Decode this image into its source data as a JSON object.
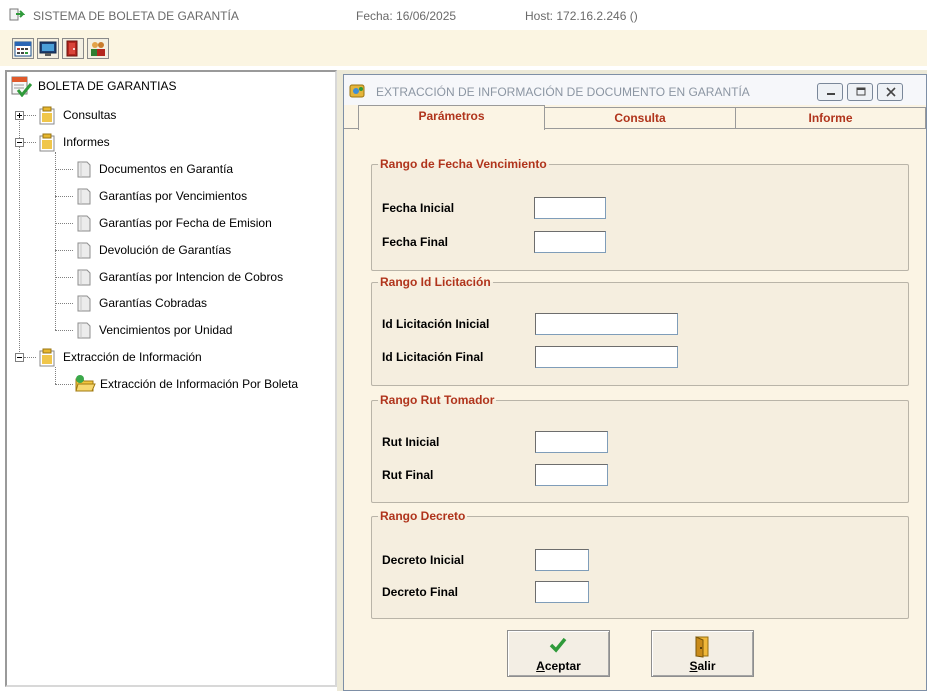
{
  "header": {
    "app_title": "SISTEMA DE BOLETA DE GARANTÍA",
    "date": "Fecha: 16/06/2025",
    "host": "Host: 172.16.2.246 ()"
  },
  "toolbar": {
    "buttons": [
      "calendar-icon",
      "monitor-icon",
      "exit-door-icon",
      "users-icon"
    ]
  },
  "tree": {
    "root": "BOLETA DE GARANTIAS",
    "consultas": "Consultas",
    "informes": "Informes",
    "informes_items": [
      "Documentos en Garantía",
      "Garantías por Vencimientos",
      "Garantías por Fecha de Emision",
      "Devolución de Garantías",
      "Garantías por Intencion de Cobros",
      "Garantías Cobradas",
      "Vencimientos por Unidad"
    ],
    "extraccion": "Extracción de Información",
    "extraccion_items": [
      "Extracción de Información Por Boleta"
    ]
  },
  "dialog": {
    "title": "EXTRACCIÓN DE INFORMACIÓN DE DOCUMENTO EN GARANTÍA",
    "tabs": [
      {
        "label": "Parámetros",
        "active": true
      },
      {
        "label": "Consulta",
        "active": false
      },
      {
        "label": "Informe",
        "active": false
      }
    ],
    "groups": {
      "fecha": {
        "legend": "Rango de Fecha Vencimiento",
        "label1": "Fecha Inicial",
        "value1": "",
        "label2": "Fecha Final",
        "value2": ""
      },
      "licitacion": {
        "legend": "Rango Id Licitación",
        "label1": "Id Licitación Inicial",
        "value1": "",
        "label2": "Id Licitación Final",
        "value2": ""
      },
      "rut": {
        "legend": "Rango Rut Tomador",
        "label1": "Rut Inicial",
        "value1": "",
        "label2": "Rut Final",
        "value2": ""
      },
      "decreto": {
        "legend": "Rango Decreto",
        "label1": "Decreto Inicial",
        "value1": "",
        "label2": "Decreto Final",
        "value2": ""
      }
    },
    "buttons": {
      "accept_first": "A",
      "accept_rest": "ceptar",
      "exit_first": "S",
      "exit_rest": "alir"
    }
  },
  "colors": {
    "accent_text": "#b0341c",
    "toolbar_bg": "#fbf5e2",
    "panel_bg": "#fbf4e4",
    "group_bg": "#f5eedf"
  }
}
